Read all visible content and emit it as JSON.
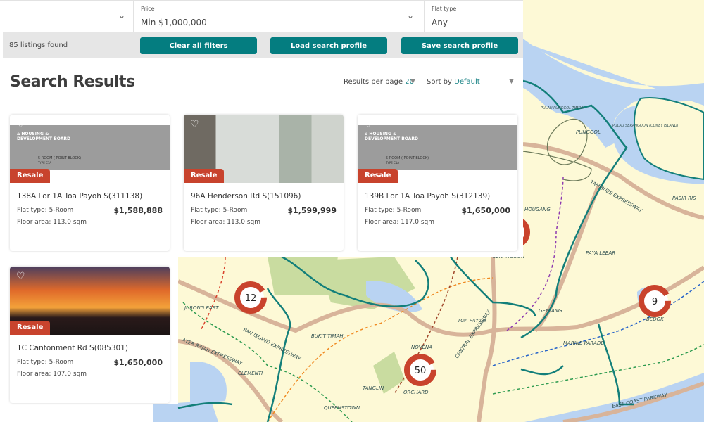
{
  "filters": {
    "first": {
      "label": "",
      "value": ""
    },
    "price": {
      "label": "Price",
      "value": "Min $1,000,000"
    },
    "flat_type": {
      "label": "Flat type",
      "value": "Any"
    }
  },
  "toolbar": {
    "count": "85 listings found",
    "clear": "Clear all filters",
    "load": "Load search profile",
    "save": "Save search profile"
  },
  "results": {
    "title": "Search Results",
    "per_page_label": "Results per page",
    "per_page": "20",
    "sort_label": "Sort by",
    "sort": "Default"
  },
  "listings": [
    {
      "badge": "Resale",
      "address": "138A Lor 1A Toa Payoh S(311138)",
      "flat_type_label": "Flat type:",
      "flat_type": "5-Room",
      "floor_area_label": "Floor area:",
      "floor_area": "113.0 sqm",
      "price": "$1,588,888",
      "image": "floorplan"
    },
    {
      "badge": "Resale",
      "address": "96A Henderson Rd S(151096)",
      "flat_type_label": "Flat type:",
      "flat_type": "5-Room",
      "floor_area_label": "Floor area:",
      "floor_area": "113.0 sqm",
      "price": "$1,599,999",
      "image": "living-room"
    },
    {
      "badge": "Resale",
      "address": "139B Lor 1A Toa Payoh S(312139)",
      "flat_type_label": "Flat type:",
      "flat_type": "5-Room",
      "floor_area_label": "Floor area:",
      "floor_area": "117.0 sqm",
      "price": "$1,650,000",
      "image": "floorplan"
    },
    {
      "badge": "Resale",
      "address": "1C Cantonment Rd S(085301)",
      "flat_type_label": "Flat type:",
      "flat_type": "5-Room",
      "floor_area_label": "Floor area:",
      "floor_area": "107.0 sqm",
      "price": "$1,650,000",
      "image": "sunset-skyline"
    }
  ],
  "floorplan": {
    "caption": "5 ROOM ( POINT BLOCK)",
    "type": "TYPE C1A",
    "brand": "HOUSING & DEVELOPMENT BOARD"
  },
  "map": {
    "clusters": [
      {
        "count": "12"
      },
      {
        "count": "50"
      },
      {
        "count": "9"
      },
      {
        "count": ""
      }
    ],
    "labels": [
      "JURONG EAST",
      "BUKIT TIMAH",
      "CLEMENTI",
      "QUEENSTOWN",
      "TANGLIN",
      "ORCHARD",
      "NOVENA",
      "TOA PAYOH",
      "SERANGOON",
      "PAYA LEBAR",
      "GEYLANG",
      "BEDOK",
      "MARINE PARADE",
      "PASIR RIS",
      "PUNGGOL",
      "HOUGANG",
      "PAN ISLAND EXPRESSWAY",
      "AYER RAJAH EXPRESSWAY",
      "CENTRAL EXPRESSWAY",
      "TAMPINES EXPRESSWAY",
      "EAST COAST PARKWAY",
      "PULAU SERANGOON (CONEY ISLAND)",
      "PULAU PUNGGOL TIMOR"
    ],
    "colors": {
      "land": "#fdf9d6",
      "water": "#b9d3f2",
      "road": "#d8b49a",
      "border": "#137f7a",
      "park": "#c9dca0",
      "cluster": "#c9432c"
    }
  },
  "colors": {
    "accent": "#047d80",
    "badge": "#c8432d",
    "result_link": "#127f82"
  }
}
